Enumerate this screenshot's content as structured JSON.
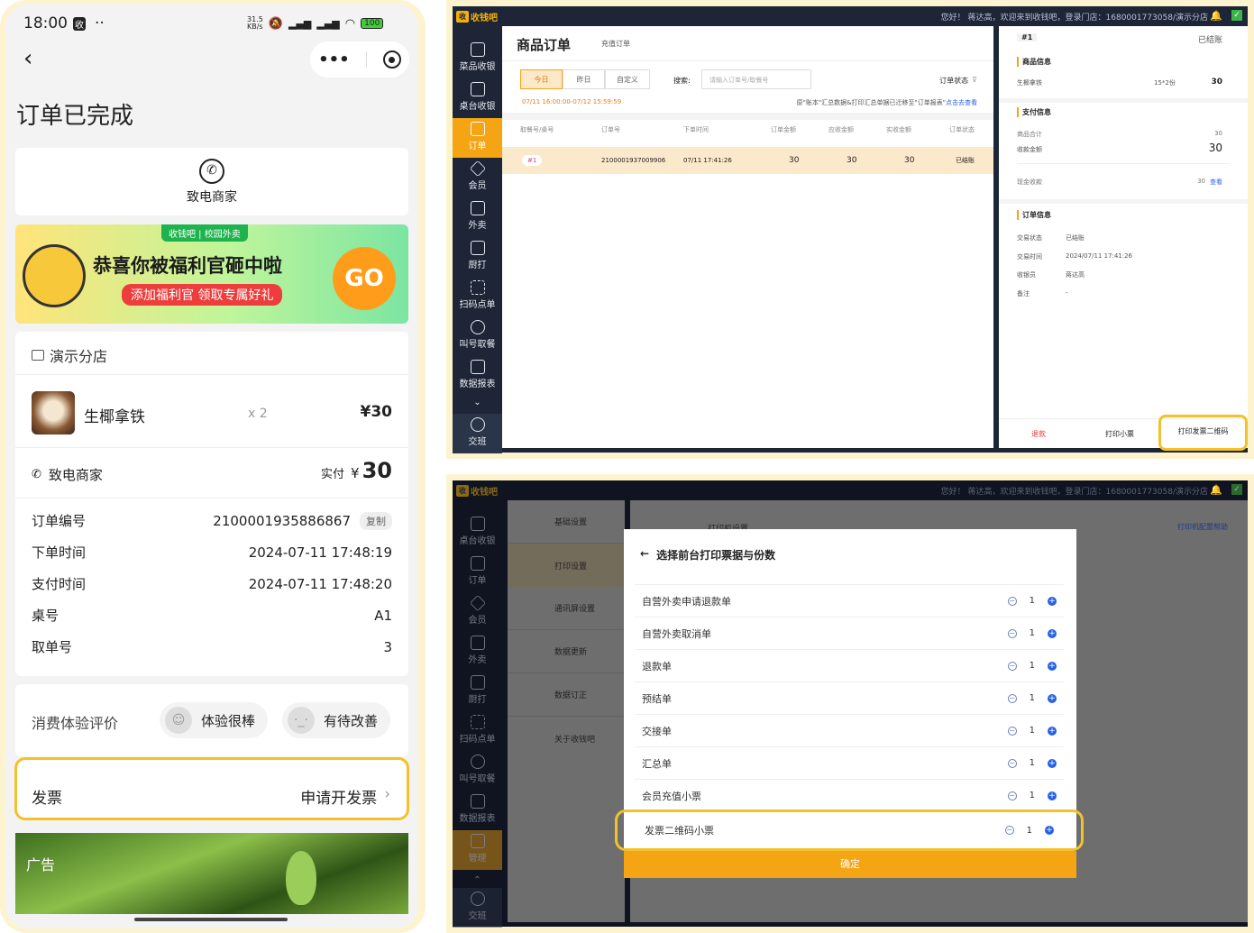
{
  "phone": {
    "status": {
      "time": "18:00",
      "app_badge": "收",
      "dots": "··",
      "speed": "31.5\nKB/s",
      "battery": "100"
    },
    "page_title": "订单已完成",
    "call_merchant": "致电商家",
    "banner": {
      "tag": "收钱吧 | 校园外卖",
      "headline": "恭喜你被福利官砸中啦",
      "sub": "添加福利官 领取专属好礼",
      "go": "GO"
    },
    "store_name": "演示分店",
    "item": {
      "name": "生椰拿铁",
      "qty": "x 2",
      "price": "¥30"
    },
    "contact": "致电商家",
    "paid_label": "实付",
    "paid_currency": "¥",
    "paid_amount": "30",
    "details": [
      {
        "label": "订单编号",
        "value": "2100001935886867",
        "copy": "复制"
      },
      {
        "label": "下单时间",
        "value": "2024-07-11 17:48:19"
      },
      {
        "label": "支付时间",
        "value": "2024-07-11 17:48:20"
      },
      {
        "label": "桌号",
        "value": "A1"
      },
      {
        "label": "取单号",
        "value": "3"
      }
    ],
    "rating": {
      "label": "消费体验评价",
      "good": "体验很棒",
      "improve": "有待改善"
    },
    "invoice": {
      "label": "发票",
      "action": "申请开发票"
    },
    "ad_label": "广告"
  },
  "pos_top": {
    "brand": "收钱吧",
    "greeting": "您好！ 蒋达高，欢迎来到收钱吧，登录门店：1680001773058/演示分店",
    "sidebar": [
      "菜品收银",
      "桌台收银",
      "订单",
      "会员",
      "外卖",
      "厨打",
      "扫码点单",
      "叫号取餐",
      "数据报表",
      "交班"
    ],
    "title": "商品订单",
    "subtab": "充值订单",
    "date_tabs": [
      "今日",
      "昨日",
      "自定义"
    ],
    "search_label": "搜索:",
    "search_placeholder": "请输入订单号/取餐号",
    "status_filter": "订单状态",
    "date_range": "07/11 16:00:00-07/12 15:59:59",
    "notice": "原\"账本\"汇总数据&打印汇总单据已迁移至\"订单报表\"",
    "notice_link": "点击去查看",
    "columns": [
      "取餐号/桌号",
      "订单号",
      "下单时间",
      "订单金额",
      "应收金额",
      "实收金额",
      "订单状态"
    ],
    "row": {
      "no": "#1",
      "order": "2100001937009906",
      "time": "07/11 17:41:26",
      "amount": "30",
      "due": "30",
      "paid": "30",
      "status": "已结账"
    },
    "detail": {
      "no": "#1",
      "state": "已结账",
      "goods_h": "商品信息",
      "goods_name": "生椰拿铁",
      "goods_qty": "15*2份",
      "goods_amt": "30",
      "pay_h": "支付信息",
      "sum_label": "商品合计",
      "sum": "30",
      "recv_label": "收款金额",
      "recv": "30",
      "cash_label": "现金收款",
      "cash": "30",
      "view": "查看",
      "order_h": "订单信息",
      "fields": [
        {
          "k": "交易状态",
          "v": "已结账"
        },
        {
          "k": "交易时间",
          "v": "2024/07/11 17:41:26"
        },
        {
          "k": "收银员",
          "v": "蒋达高"
        },
        {
          "k": "备注",
          "v": "-"
        }
      ],
      "refund": "退款",
      "print_receipt": "打印小票",
      "print_invoice": "打印发票二维码"
    }
  },
  "pos_bottom": {
    "brand": "收钱吧",
    "greeting": "您好！ 蒋达高，欢迎来到收钱吧，登录门店：1680001773058/演示分店",
    "sidebar": [
      "桌台收银",
      "订单",
      "会员",
      "外卖",
      "厨打",
      "扫码点单",
      "叫号取餐",
      "数据报表",
      "管理",
      "交班"
    ],
    "settings_menu": [
      "基础设置",
      "打印设置",
      "通讯屏设置",
      "数据更新",
      "数据订正",
      "关于收钱吧"
    ],
    "printer_title": "打印机设置",
    "printer_help": "打印机配置帮助",
    "dialog_title": "选择前台打印票据与份数",
    "items": [
      {
        "name": "自营外卖申请退款单",
        "qty": "1"
      },
      {
        "name": "自营外卖取消单",
        "qty": "1"
      },
      {
        "name": "退款单",
        "qty": "1"
      },
      {
        "name": "预结单",
        "qty": "1"
      },
      {
        "name": "交接单",
        "qty": "1"
      },
      {
        "name": "汇总单",
        "qty": "1"
      },
      {
        "name": "会员充值小票",
        "qty": "1"
      },
      {
        "name": "发票二维码小票",
        "qty": "1"
      }
    ],
    "confirm": "确定"
  }
}
